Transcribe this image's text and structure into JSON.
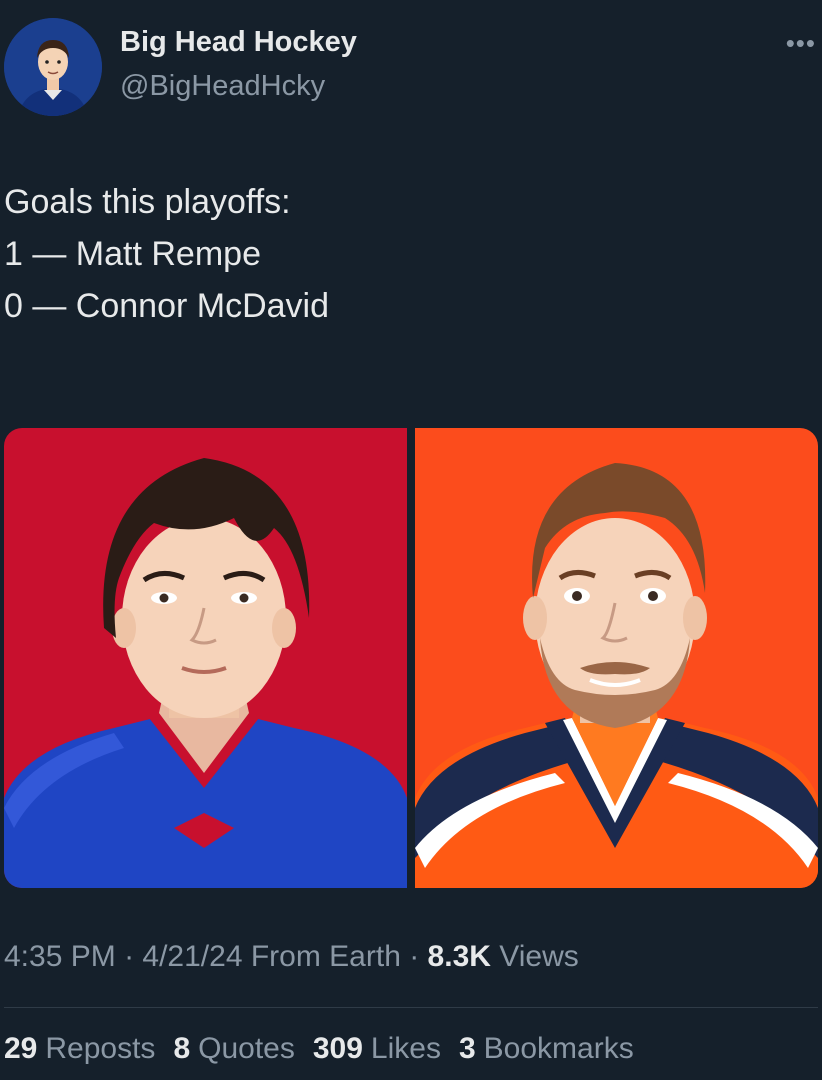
{
  "author": {
    "display_name": "Big Head Hockey",
    "handle": "@BigHeadHcky"
  },
  "tweet": {
    "lines": [
      "Goals this playoffs:",
      "",
      "1 — Matt Rempe",
      "0 — Connor McDavid"
    ]
  },
  "media": [
    {
      "subject": "Matt Rempe illustration",
      "background": "#c8102e",
      "jersey": "#1f45c4"
    },
    {
      "subject": "Connor McDavid illustration",
      "background": "#fc4c1c",
      "jersey": "#ff5a14"
    }
  ],
  "meta": {
    "time": "4:35 PM",
    "date": "4/21/24",
    "source": "From Earth",
    "views_count": "8.3K",
    "views_label": "Views"
  },
  "stats": {
    "reposts_count": "29",
    "reposts_label": "Reposts",
    "quotes_count": "8",
    "quotes_label": "Quotes",
    "likes_count": "309",
    "likes_label": "Likes",
    "bookmarks_count": "3",
    "bookmarks_label": "Bookmarks"
  },
  "icons": {
    "more": "more-horizontal-icon"
  }
}
